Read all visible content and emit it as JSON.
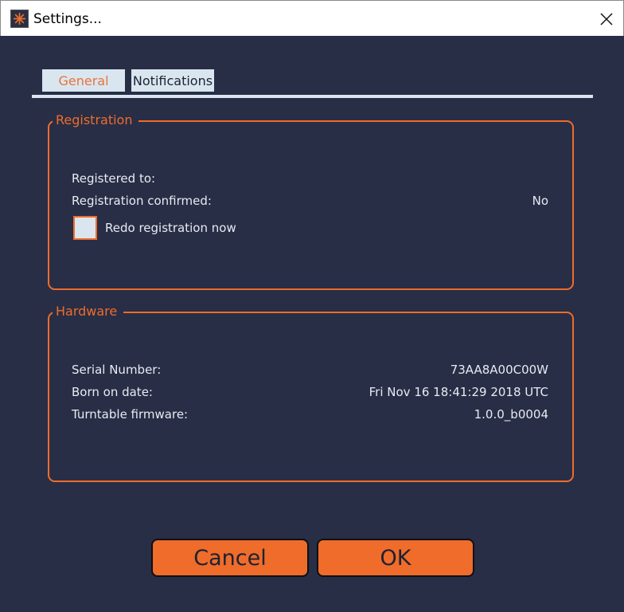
{
  "window": {
    "title": "Settings...",
    "icon": "asterisk-logo-icon",
    "close_icon": "close-icon"
  },
  "tabs": [
    {
      "label": "General",
      "active": true
    },
    {
      "label": "Notifications",
      "active": false
    }
  ],
  "registration": {
    "legend": "Registration",
    "rows": [
      {
        "label": "Registered to:",
        "value": ""
      },
      {
        "label": "Registration confirmed:",
        "value": "No"
      }
    ],
    "redo_label": "Redo registration now",
    "redo_checked": false
  },
  "hardware": {
    "legend": "Hardware",
    "rows": [
      {
        "label": "Serial Number:",
        "value": "73AA8A00C00W"
      },
      {
        "label": "Born on date:",
        "value": "Fri Nov 16 18:41:29 2018 UTC"
      },
      {
        "label": "Turntable firmware:",
        "value": "1.0.0_b0004"
      }
    ]
  },
  "buttons": {
    "cancel": "Cancel",
    "ok": "OK"
  },
  "colors": {
    "background": "#282e46",
    "accent": "#ef6c2a",
    "tab_bg": "#d9e6f0",
    "text": "#e7ebf2"
  }
}
